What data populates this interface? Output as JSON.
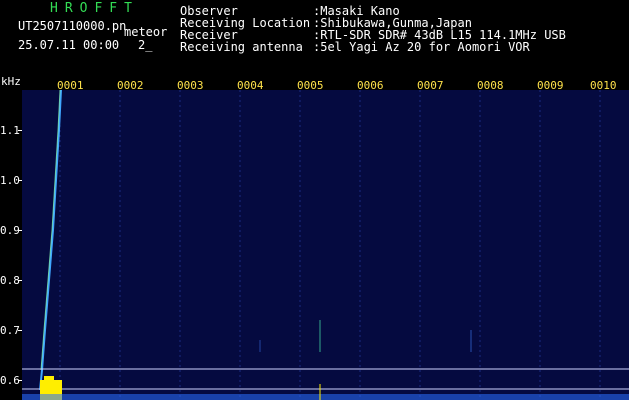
{
  "header": {
    "brand": "HROFFT",
    "filename": "UT2507110000.pn",
    "tag": "meteor",
    "timestamp": "25.07.11 00:00",
    "count": "2_",
    "fields": [
      {
        "label": "Observer",
        "value": ":Masaki Kano"
      },
      {
        "label": "Receiving Location",
        "value": ":Shibukawa,Gunma,Japan"
      },
      {
        "label": "Receiver",
        "value": ":RTL-SDR SDR# 43dB L15 114.1MHz USB"
      },
      {
        "label": "Receiving antenna",
        "value": ":5el Yagi Az 20 for Aomori VOR"
      }
    ]
  },
  "axis": {
    "unit": "kHz",
    "y_ticks": [
      "1.1",
      "1.0",
      "0.9",
      "0.8",
      "0.7",
      "0.6"
    ],
    "x_ticks": [
      "0001",
      "0002",
      "0003",
      "0004",
      "0005",
      "0006",
      "0007",
      "0008",
      "0009",
      "0010"
    ]
  },
  "colors": {
    "background": "#050a40",
    "trace": "#3fa6ff",
    "burst": "#ffee00",
    "grid": "#ffffff",
    "label": "#ffe24a"
  }
}
